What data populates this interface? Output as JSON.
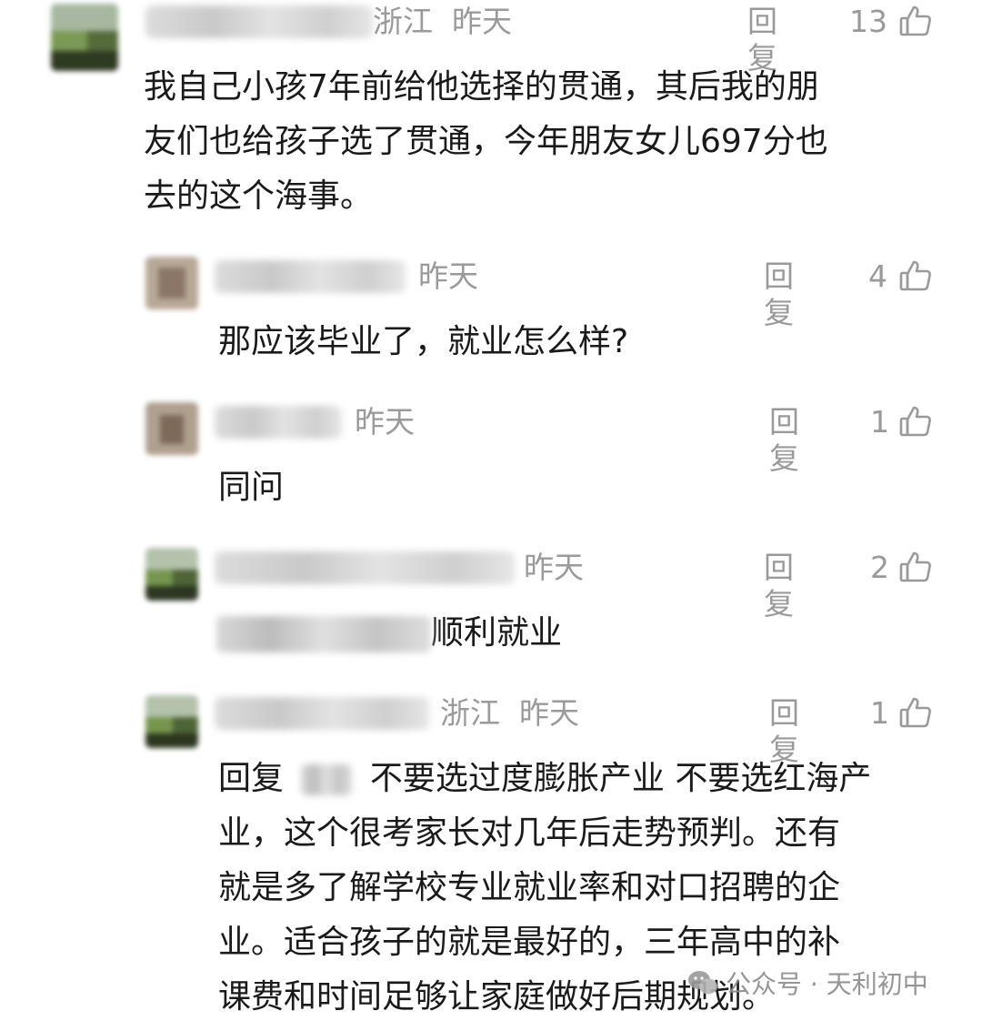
{
  "comments": [
    {
      "location": "浙江",
      "time": "昨天",
      "reply_label": "回复",
      "likes": "13",
      "lines": [
        "我自己小孩7年前给他选择的贯通，其后我的朋",
        "友们也给孩子选了贯通，今年朋友女儿697分也",
        "去的这个海事。"
      ]
    },
    {
      "time": "昨天",
      "reply_label": "回复",
      "likes": "4",
      "text": "那应该毕业了，就业怎么样?"
    },
    {
      "time": "昨天",
      "reply_label": "回复",
      "likes": "1",
      "text": "同问"
    },
    {
      "time": "昨天",
      "reply_label": "回复",
      "likes": "2",
      "text": "顺利就业"
    },
    {
      "location": "浙江",
      "time": "昨天",
      "reply_label": "回复",
      "likes": "1",
      "reply_prefix": "回复",
      "first_line_rest": "不要选过度膨胀产业 不要选红海产",
      "lines": [
        "业，这个很考家长对几年后走势预判。还有",
        "就是多了解学校专业就业率和对口招聘的企",
        "业。适合孩子的就是最好的，三年高中的补",
        "课费和时间足够让家庭做好后期规划。"
      ]
    }
  ],
  "watermark": {
    "text": "公众号 · 天利初中"
  },
  "colors": {
    "meta": "#9a9a9a",
    "text": "#1a1a1a"
  }
}
